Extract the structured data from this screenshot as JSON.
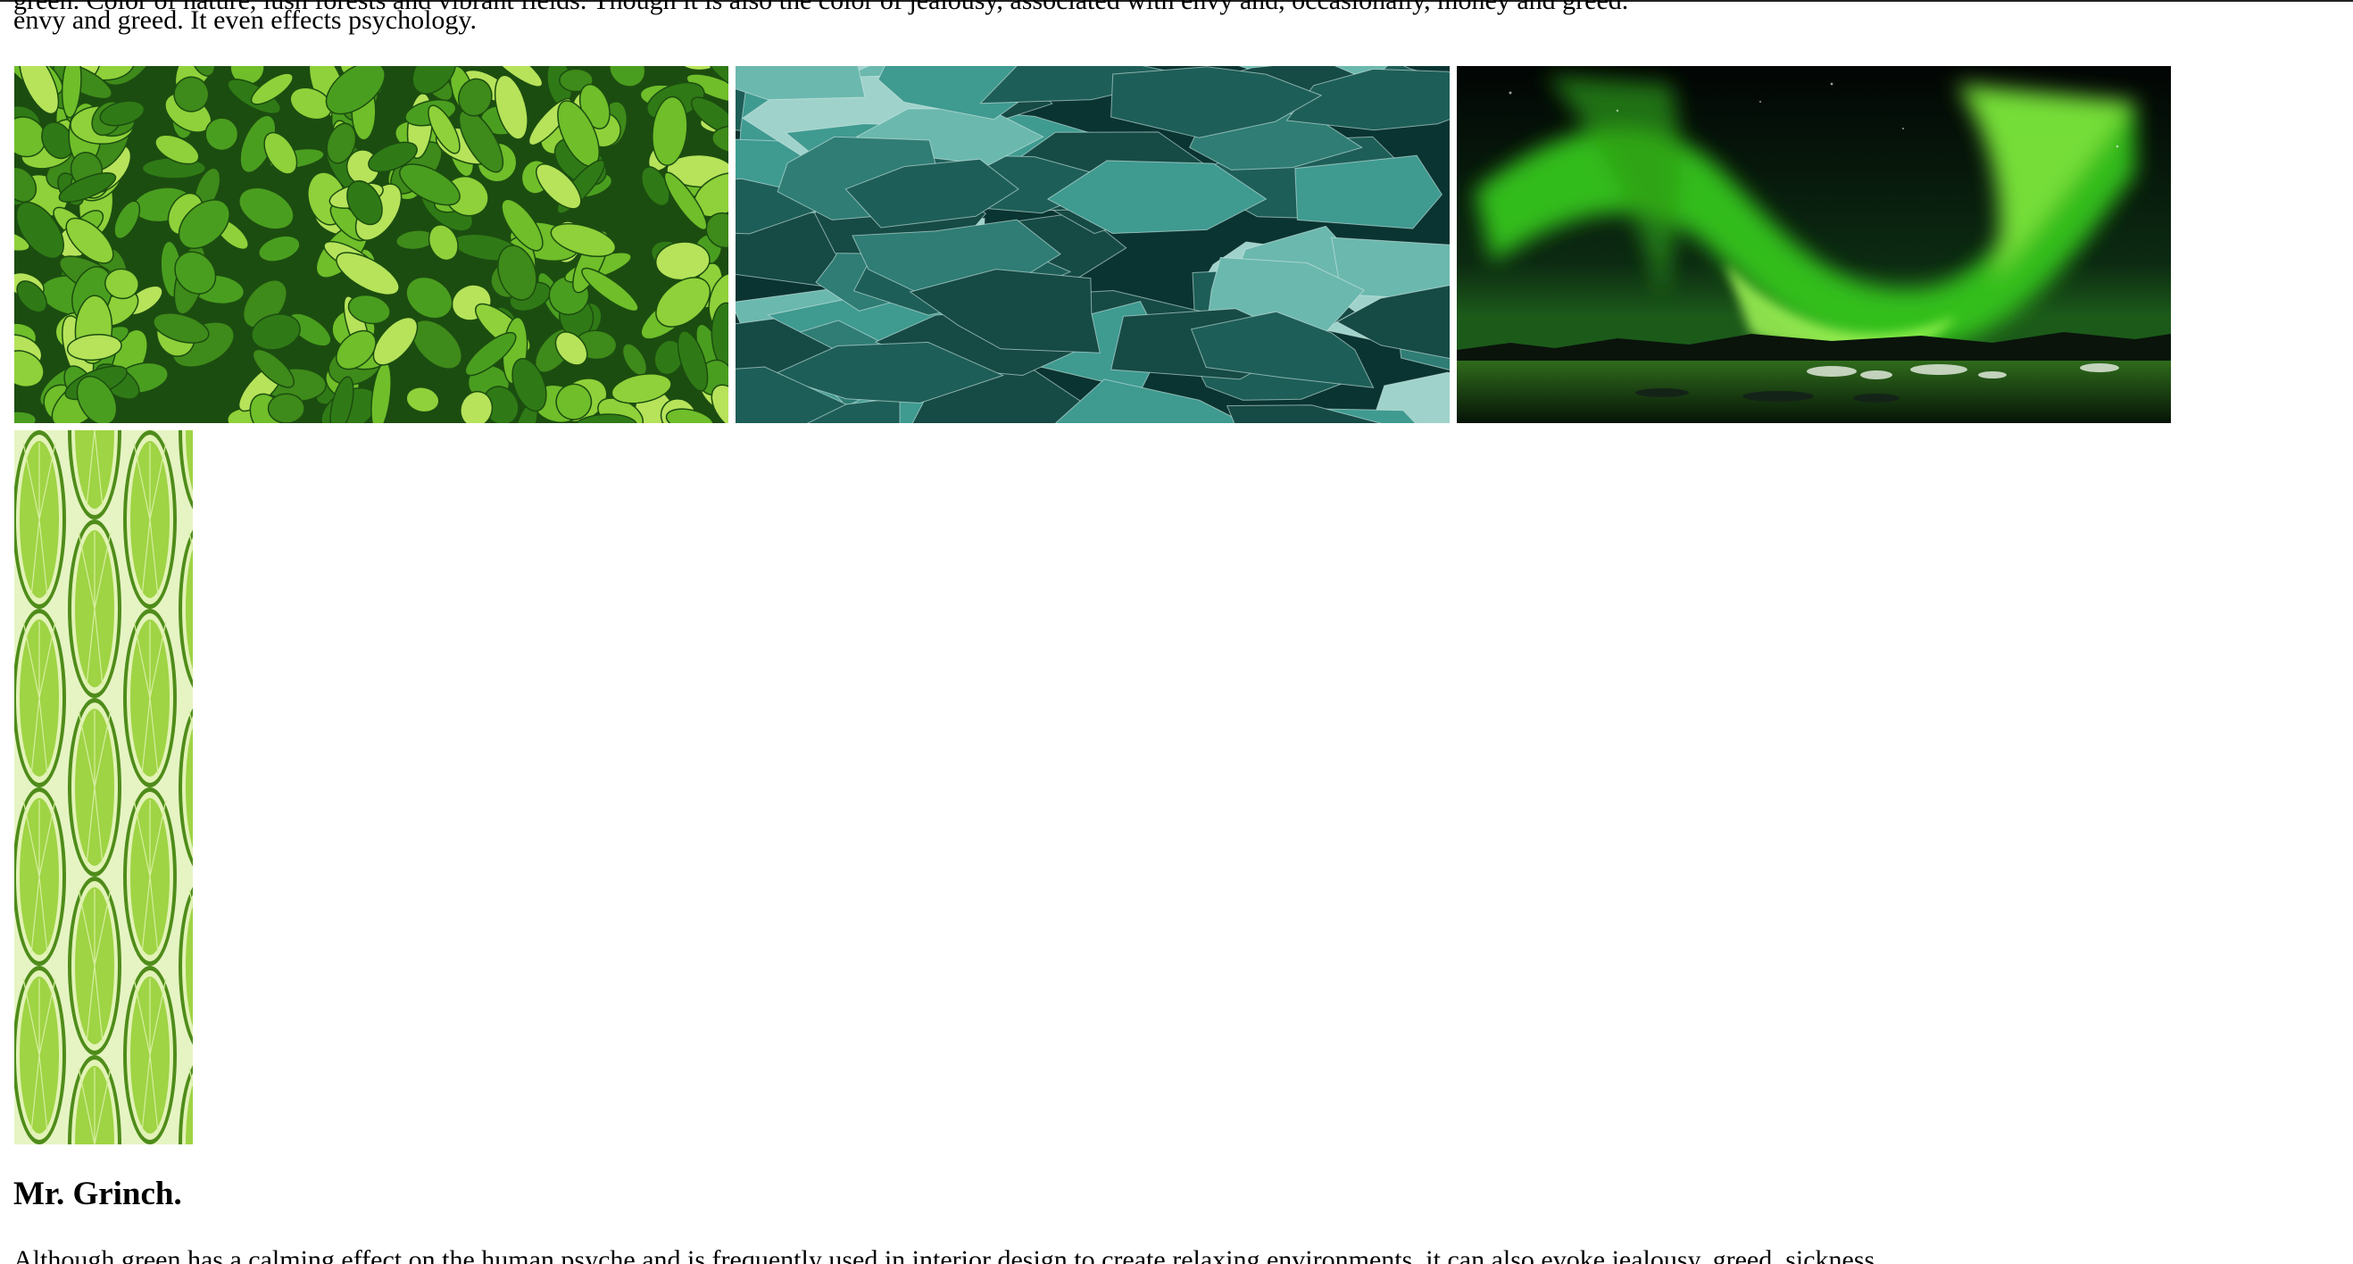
{
  "article": {
    "intro_clipped_line": "green. Color of nature, lush forests and vibrant fields. Though it is also the color of jealousy, associated with envy and, occasionally, money and greed.",
    "intro_last_line": "envy and greed. It even effects psychology.",
    "gallery": {
      "images": [
        {
          "subject": "green leaves",
          "colors": [
            "#1f5a12",
            "#6fbe2a",
            "#b6e35a"
          ]
        },
        {
          "subject": "teal glass rocks",
          "colors": [
            "#0b3c38",
            "#3f9a90",
            "#cfe9e4"
          ]
        },
        {
          "subject": "northern lights over a lake",
          "colors": [
            "#050c08",
            "#3fd21c",
            "#0f2a14"
          ]
        },
        {
          "subject": "lime slices",
          "colors": [
            "#4f8c1a",
            "#9fd444",
            "#e3f3b8"
          ]
        }
      ]
    },
    "section_heading": "Mr. Grinch.",
    "section_clipped_line": "Although green has a calming effect on the human psyche and is frequently used in interior design to create relaxing environments, it can also evoke jealousy, greed, sickness."
  }
}
